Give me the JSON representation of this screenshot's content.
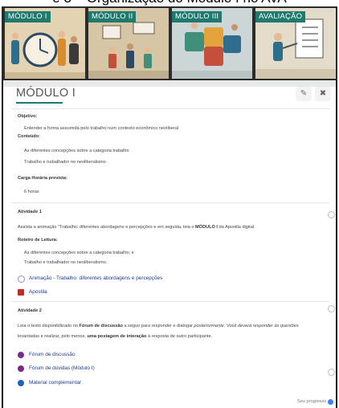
{
  "page_heading": "e 3 – Organização do Módulo I no AVA",
  "tabs": [
    {
      "label": "MÓDULO I",
      "bg": "#e3d3b2"
    },
    {
      "label": "MÓDULO II",
      "bg": "#d7c6a6"
    },
    {
      "label": "MÓDULO III",
      "bg": "#cdd6d6"
    },
    {
      "label": "AVALIAÇÃO",
      "bg": "#e4dcca"
    }
  ],
  "module": {
    "title": "MÓDULO I",
    "edit_icon": "pencil-icon",
    "close_icon": "close-icon"
  },
  "intro": {
    "objetivo_label": "Objetivo:",
    "objetivo_text": "Entender a forma assumida pelo trabalho num contexto econômico neoliberal",
    "conteudo_label": "Conteúdo:",
    "conteudo_items": [
      "As diferentes concepções sobre a categoria trabalho",
      "Trabalho e trabalhador no neoliberalismo"
    ],
    "carga_label": "Carga Horária prevista:",
    "carga_value": "6 horas"
  },
  "atividade1": {
    "title": "Atividade 1",
    "text_before": "Assista a animação \"Trabalho: diferentes abordagens e percepções e em seguida, leia o ",
    "text_bold": "MÓDULO I",
    "text_after": " da Apostila digital.",
    "roteiro_label": "Roteiro de Leitura:",
    "roteiro_items": [
      "As diferentes concepções sobre a categoria trabalho; e",
      "Trabalho e trabalhador no neoliberalismo."
    ],
    "links": [
      {
        "label": "Animação - Trabalho: diferentes abordagens e percepções",
        "icon": "video-icon"
      },
      {
        "label": "Apostila",
        "icon": "pdf-icon"
      }
    ]
  },
  "atividade2": {
    "title": "Atividade 2",
    "line1_a": "Leia o texto disponibilizado no ",
    "line1_b": "Fórum de discussão",
    "line1_c": " a seguir para responder e dialogar ",
    "line1_d": "posteriormente. Você deverá responder às questões",
    "line2_a": "levantadas e realizar, pelo menos, ",
    "line2_b": "uma postagem de interação",
    "line2_c": " à resposta de outro participante.",
    "links": [
      {
        "label": "Fórum de discussão",
        "icon": "forum-icon"
      },
      {
        "label": "Fórum de dúvidas (Módulo I)",
        "icon": "forum-icon"
      },
      {
        "label": "Material complementar",
        "icon": "folder-icon"
      }
    ]
  },
  "progress_label": "Seu progresso",
  "progress_icon": "help-icon",
  "colors": {
    "accent": "#1f7a6e",
    "link": "#1f3b8a",
    "forum": "#7b2a8a",
    "pdf": "#c62828",
    "folder": "#1565c0"
  }
}
